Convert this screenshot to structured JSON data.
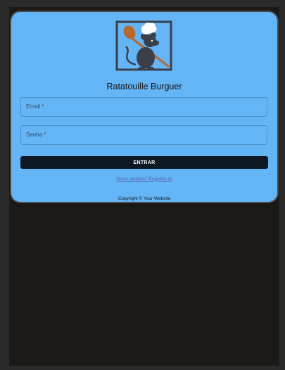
{
  "app": {
    "title": "Ratatouille Burguer"
  },
  "form": {
    "email_label": "Email *",
    "password_label": "Senha *",
    "submit_label": "ENTRAR",
    "register_link": "Novo usuário? Registre-se"
  },
  "footer": {
    "copyright": "Copyright © Your Website"
  },
  "icons": {
    "logo": "chef-rat-with-spoon-logo"
  },
  "colors": {
    "card_background": "#64b5f6",
    "page_background": "#1c1a17",
    "button_background": "#0d1a26",
    "link": "#5a55a8"
  }
}
